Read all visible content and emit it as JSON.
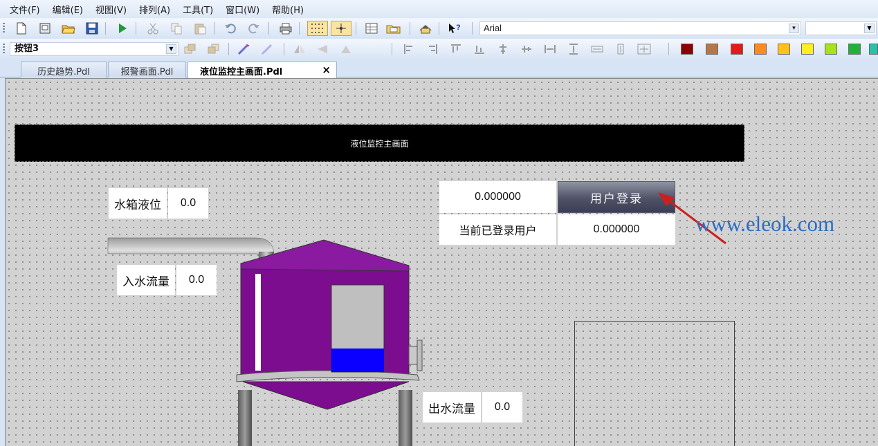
{
  "menu": [
    "文件(F)",
    "编辑(E)",
    "视图(V)",
    "排列(A)",
    "工具(T)",
    "窗口(W)",
    "帮助(H)"
  ],
  "toolbar": {
    "font_name": "Arial",
    "font_size": "",
    "object_selector": "按钮3"
  },
  "palette": [
    "#8b0000",
    "#b5764a",
    "#e31a1a",
    "#ff8a1f",
    "#ffc21a",
    "#ffee22",
    "#a8e21b",
    "#22b03a",
    "#25c3a8"
  ],
  "tabs": [
    {
      "label": "历史趋势.Pdl",
      "active": false
    },
    {
      "label": "报警画面.Pdl",
      "active": false
    },
    {
      "label": "液位监控主画面.Pdl",
      "active": true,
      "close": "×"
    }
  ],
  "canvas": {
    "title": "液位监控主画面",
    "tank_level_label": "水箱液位",
    "tank_level_value": "0.0",
    "inflow_label": "入水流量",
    "inflow_value": "0.0",
    "outflow_label": "出水流量",
    "outflow_value": "0.0",
    "login_value": "0.000000",
    "login_button": "用户登录",
    "current_user_label": "当前已登录用户",
    "current_user_value": "0.000000",
    "tank_fill_level": 0.35
  },
  "watermark": "www.eleok.com",
  "colors": {
    "tank_body": "#7c0d8f",
    "tank_fill": "#0a00ff",
    "arrow": "#d11a1a"
  }
}
